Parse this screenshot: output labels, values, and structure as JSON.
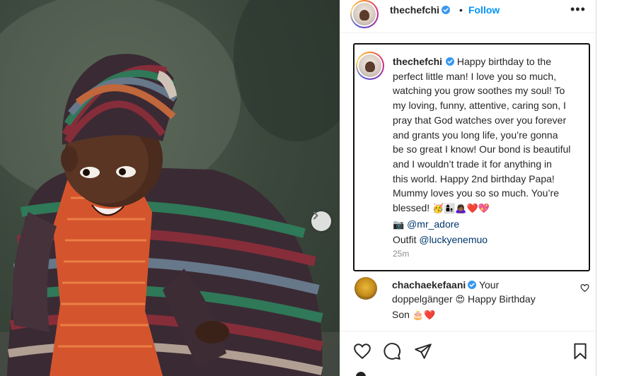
{
  "post": {
    "author": "thechefchi",
    "follow_label": "Follow",
    "dot": "•",
    "more_label": "•••"
  },
  "caption": {
    "username": "thechefchi",
    "lines": [
      "Happy birthday to the",
      "perfect little man! I love you so much,",
      "watching you grow soothes my soul! To",
      "my loving, funny, attentive, caring son, I",
      "pray that God watches over you forever",
      "and grants you long life, you’re gonna",
      "be so great I know! Our bond is beautiful",
      "and I wouldn’t trade it for anything in",
      "this world. Happy 2nd birthday Papa!",
      "Mummy loves you so so much. You’re",
      "blessed!"
    ],
    "blessed_emojis": "🥳👩‍👦🙇🏾‍♀️❤️💖",
    "camera_emoji": "📷",
    "photo_credit": "@mr_adore",
    "outfit_label": "Outfit",
    "outfit_credit": "@luckyenemuo",
    "time": "25m"
  },
  "comment": {
    "username": "chachaekefaani",
    "text_1": "Your",
    "text_2": "doppelgänger",
    "emoji_1": "😍",
    "text_3": "Happy Birthday",
    "text_4": "Son",
    "emoji_2": "🎂❤️"
  },
  "icons": {
    "verified": "verified-badge-icon",
    "next": "chevron-right-icon",
    "like": "heart-icon",
    "comment": "comment-icon",
    "share": "paper-plane-icon",
    "save": "bookmark-icon"
  },
  "colors": {
    "accent": "#0095f6",
    "verified": "#3897f0",
    "mention": "#00376b",
    "muted": "#8e8e8e"
  }
}
